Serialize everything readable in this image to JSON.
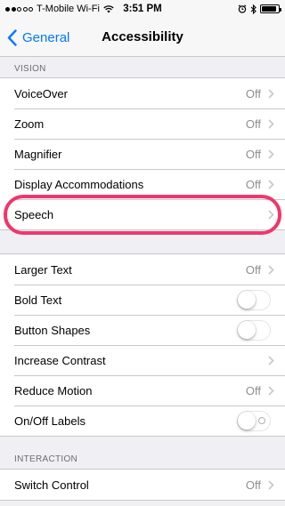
{
  "status_bar": {
    "carrier": "T-Mobile Wi-Fi",
    "time": "3:51 PM",
    "signal_dots_full": 2,
    "signal_dots_total": 5,
    "battery_level": 0.9
  },
  "nav": {
    "back_label": "General",
    "title": "Accessibility"
  },
  "vision": {
    "header": "VISION",
    "items": [
      {
        "label": "VoiceOver",
        "value": "Off"
      },
      {
        "label": "Zoom",
        "value": "Off"
      },
      {
        "label": "Magnifier",
        "value": "Off"
      },
      {
        "label": "Display Accommodations",
        "value": "Off"
      },
      {
        "label": "Speech",
        "value": ""
      }
    ]
  },
  "text": {
    "larger_text": {
      "label": "Larger Text",
      "value": "Off"
    },
    "bold_text": {
      "label": "Bold Text",
      "on": false
    },
    "button_shapes": {
      "label": "Button Shapes",
      "on": false
    },
    "increase_contrast": {
      "label": "Increase Contrast"
    },
    "reduce_motion": {
      "label": "Reduce Motion",
      "value": "Off"
    },
    "onoff_labels": {
      "label": "On/Off Labels",
      "on": false
    }
  },
  "interaction": {
    "header": "INTERACTION",
    "switch_control": {
      "label": "Switch Control",
      "value": "Off"
    }
  },
  "colors": {
    "accent": "#007aff",
    "highlight": "#f1366c",
    "background": "#efeff4",
    "secondary_text": "#8e8e93"
  }
}
